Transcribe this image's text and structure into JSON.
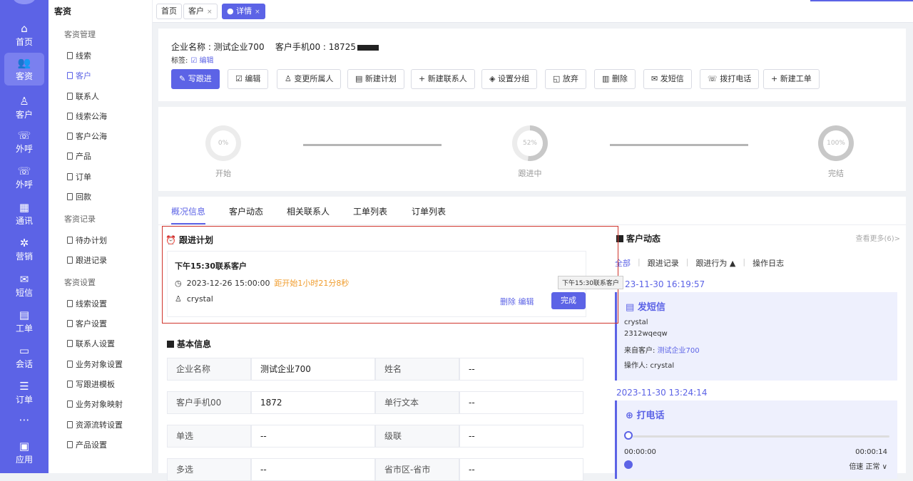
{
  "rail": {
    "items": [
      {
        "icon": "home-icon",
        "glyph": "⌂",
        "label": "首页"
      },
      {
        "icon": "users-icon",
        "glyph": "👥",
        "label": "客资"
      },
      {
        "icon": "user-icon",
        "glyph": "♙",
        "label": "客户"
      },
      {
        "icon": "phone-out-icon",
        "glyph": "☏",
        "label": "外呼"
      },
      {
        "icon": "phone-call-icon",
        "glyph": "☏",
        "label": "外呼"
      },
      {
        "icon": "contacts-icon",
        "glyph": "▦",
        "label": "通讯"
      },
      {
        "icon": "marketing-icon",
        "glyph": "✲",
        "label": "营销"
      },
      {
        "icon": "sms-icon",
        "glyph": "✉",
        "label": "短信"
      },
      {
        "icon": "clipboard-icon",
        "glyph": "▤",
        "label": "工单"
      },
      {
        "icon": "chat-icon",
        "glyph": "▭",
        "label": "会话"
      },
      {
        "icon": "order-icon",
        "glyph": "☰",
        "label": "订单"
      },
      {
        "icon": "more-icon",
        "glyph": "⋯",
        "label": ""
      },
      {
        "icon": "apps-icon",
        "glyph": "▣",
        "label": "应用"
      }
    ]
  },
  "submenu": {
    "title": "客资",
    "sections": [
      {
        "label": "客资管理"
      },
      {
        "label": "客资记录"
      },
      {
        "label": "客资设置"
      }
    ],
    "links": [
      "线索",
      "客户",
      "联系人",
      "线索公海",
      "客户公海",
      "产品",
      "订单",
      "回款",
      "待办计划",
      "跟进记录",
      "线索设置",
      "客户设置",
      "联系人设置",
      "业务对象设置",
      "写跟进模板",
      "业务对象映射",
      "资源流转设置",
      "产品设置"
    ]
  },
  "tabs": {
    "home": "首页",
    "customer": "客户",
    "detail": "详情",
    "close": "×"
  },
  "header": {
    "company_line": "企业名称 : 测试企业700",
    "phone_line": "客户手机00 : 18725",
    "tag_label": "标签:",
    "tag_edit": "☑ 编辑"
  },
  "actions": [
    {
      "label": "✎ 写跟进",
      "name": "write-followup-button"
    },
    {
      "label": "☑ 编辑",
      "name": "edit-button"
    },
    {
      "label": "♙ 变更所属人",
      "name": "change-owner-button"
    },
    {
      "label": "▤ 新建计划",
      "name": "new-plan-button"
    },
    {
      "label": "+ 新建联系人",
      "name": "new-contact-button"
    },
    {
      "label": "◈ 设置分组",
      "name": "set-group-button"
    },
    {
      "label": "◱ 放弃",
      "name": "abandon-button"
    },
    {
      "label": "▥ 删除",
      "name": "delete-button"
    },
    {
      "label": "✉ 发短信",
      "name": "send-sms-button"
    },
    {
      "label": "☏ 拨打电话",
      "name": "call-button"
    },
    {
      "label": "+ 新建工单",
      "name": "new-ticket-button"
    }
  ],
  "progress": {
    "stages": [
      {
        "pct": "0%",
        "label": "开始",
        "value": 0
      },
      {
        "pct": "52%",
        "label": "跟进中",
        "value": 52
      },
      {
        "pct": "100%",
        "label": "完结",
        "value": 100
      }
    ]
  },
  "detail_tabs": [
    "概况信息",
    "客户动态",
    "相关联系人",
    "工单列表",
    "订单列表"
  ],
  "plan": {
    "section_title": "跟进计划",
    "title": "下午15:30联系客户",
    "datetime": "2023-12-26 15:00:00",
    "countdown": "距开始1小时21分8秒",
    "user": "crystal",
    "delete": "删除",
    "edit": "编辑",
    "done": "完成"
  },
  "basic": {
    "section_title": "基本信息",
    "rows": [
      {
        "k1": "企业名称",
        "v1": "测试企业700",
        "k2": "姓名",
        "v2": "--"
      },
      {
        "k1": "客户手机00",
        "v1": "1872",
        "k2": "单行文本",
        "v2": "--"
      },
      {
        "k1": "单选",
        "v1": "--",
        "k2": "级联",
        "v2": "--"
      },
      {
        "k1": "多选",
        "v1": "--",
        "k2": "省市区-省市",
        "v2": "--"
      }
    ]
  },
  "feed": {
    "title": "客户动态",
    "more": "查看更多(6)>",
    "filters": [
      "全部",
      "跟进记录",
      "跟进行为 ▲",
      "操作日志"
    ],
    "tooltip": "下午15:30联系客户",
    "entry1": {
      "time": "23-11-30 16:19:57",
      "type": "发短信",
      "user": "crystal",
      "content": "2312wqeqw",
      "from_label": "来自客户:",
      "from_value": "测试企业700",
      "operator": "操作人: crystal"
    },
    "entry2": {
      "time": "2023-11-30 13:24:14",
      "type": "打电话",
      "start": "00:00:00",
      "end": "00:00:14",
      "speed": "倍速 正常 ∨"
    }
  }
}
